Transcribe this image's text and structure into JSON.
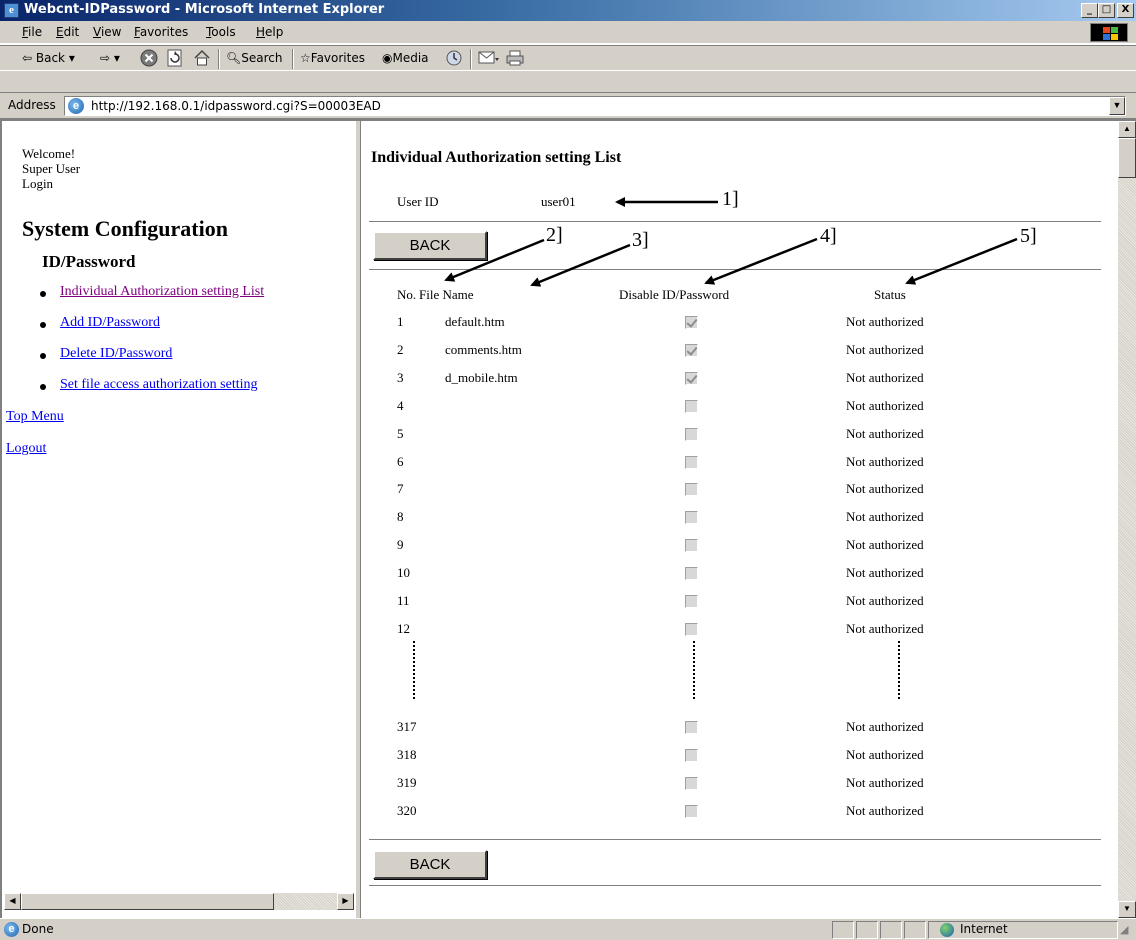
{
  "window": {
    "title": "Webcnt-IDPassword - Microsoft Internet Explorer",
    "minimize": "_",
    "maximize": "□",
    "close": "X"
  },
  "menu": [
    "File",
    "Edit",
    "View",
    "Favorites",
    "Tools",
    "Help"
  ],
  "toolbar": {
    "back": "Back",
    "search": "Search",
    "favorites": "Favorites",
    "media": "Media"
  },
  "address": {
    "label": "Address",
    "url": "http://192.168.0.1/idpassword.cgi?S=00003EAD"
  },
  "sidebar": {
    "welcome": "Welcome!",
    "user": "Super User",
    "login": "Login",
    "heading": "System Configuration",
    "subheading": "ID/Password",
    "links": [
      "Individual Authorization setting List",
      "Add ID/Password",
      "Delete ID/Password",
      "Set file access authorization setting"
    ],
    "top_menu": "Top Menu",
    "logout": "Logout"
  },
  "main": {
    "title": "Individual Authorization setting List",
    "user_id_label": "User ID",
    "user_id_value": "user01",
    "back_label": "BACK",
    "columns": [
      "No.",
      "File Name",
      "Disable ID/Password",
      "Status"
    ],
    "rows": [
      {
        "no": "1",
        "file": "default.htm",
        "checked": true,
        "status": "Not authorized"
      },
      {
        "no": "2",
        "file": "comments.htm",
        "checked": true,
        "status": "Not authorized"
      },
      {
        "no": "3",
        "file": "d_mobile.htm",
        "checked": true,
        "status": "Not authorized"
      },
      {
        "no": "4",
        "file": "",
        "checked": false,
        "status": "Not authorized"
      },
      {
        "no": "5",
        "file": "",
        "checked": false,
        "status": "Not authorized"
      },
      {
        "no": "6",
        "file": "",
        "checked": false,
        "status": "Not authorized"
      },
      {
        "no": "7",
        "file": "",
        "checked": false,
        "status": "Not authorized"
      },
      {
        "no": "8",
        "file": "",
        "checked": false,
        "status": "Not authorized"
      },
      {
        "no": "9",
        "file": "",
        "checked": false,
        "status": "Not authorized"
      },
      {
        "no": "10",
        "file": "",
        "checked": false,
        "status": "Not authorized"
      },
      {
        "no": "11",
        "file": "",
        "checked": false,
        "status": "Not authorized"
      },
      {
        "no": "12",
        "file": "",
        "checked": false,
        "status": "Not authorized"
      },
      {
        "no": "317",
        "file": "",
        "checked": false,
        "status": "Not authorized"
      },
      {
        "no": "318",
        "file": "",
        "checked": false,
        "status": "Not authorized"
      },
      {
        "no": "319",
        "file": "",
        "checked": false,
        "status": "Not authorized"
      },
      {
        "no": "320",
        "file": "",
        "checked": false,
        "status": "Not authorized"
      }
    ]
  },
  "annotations": [
    "1]",
    "2]",
    "3]",
    "4]",
    "5]"
  ],
  "status": {
    "text": "Done",
    "zone": "Internet"
  },
  "colors": {
    "link": "#0000ee",
    "visited_link": "#800080",
    "chrome": "#d4d0c8",
    "titlebar": "#0a246a"
  }
}
